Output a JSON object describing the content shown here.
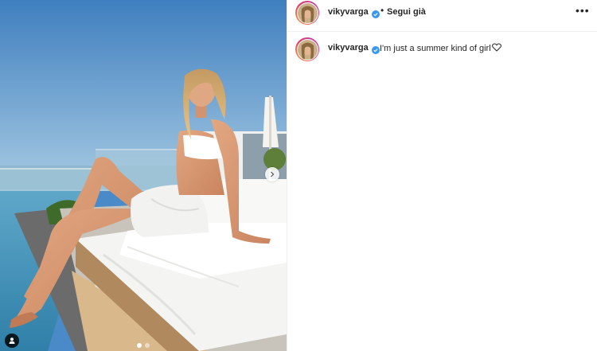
{
  "post": {
    "username": "vikyvarga",
    "follow_status": "Segui già",
    "separator": "•",
    "more_icon": "more-horizontal-icon",
    "caption": {
      "username": "vikyvarga",
      "text": "I'm just a summer kind of girl",
      "emoji_icon": "heart-outline-icon"
    },
    "carousel": {
      "total_slides": 2,
      "active_slide": 1,
      "next_icon": "chevron-right-icon",
      "tag_icon": "user-tag-icon"
    }
  },
  "colors": {
    "text": "#262626",
    "verified": "#3897f0",
    "divider": "#efefef",
    "story_ring": [
      "#f9a03f",
      "#e63c6a",
      "#b43ab6"
    ]
  }
}
